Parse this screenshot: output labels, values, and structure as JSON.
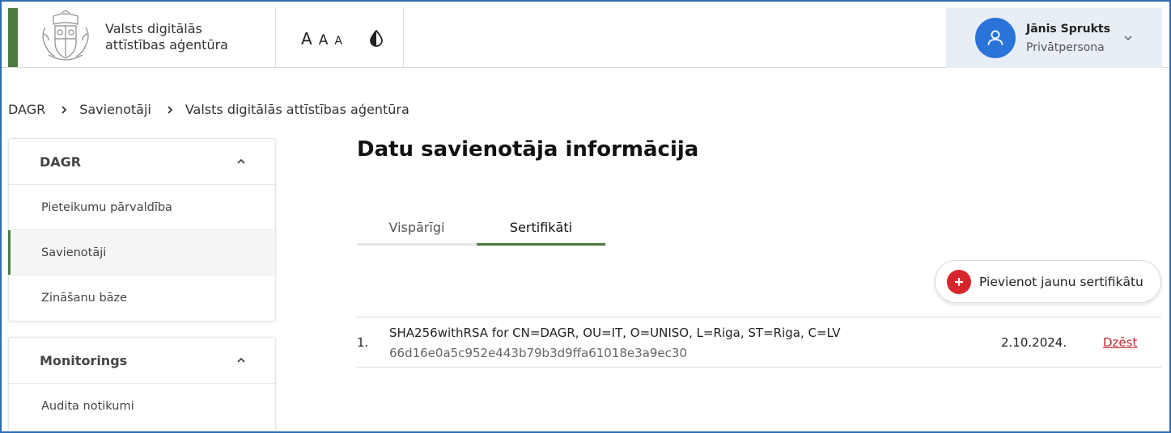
{
  "header": {
    "org_name_line1": "Valsts digitālās",
    "org_name_line2": "attīstības aģentūra",
    "font_size_large": "A",
    "font_size_medium": "A",
    "font_size_small": "A",
    "user": {
      "name": "Jānis Sprukts",
      "role": "Privātpersona"
    }
  },
  "breadcrumb": [
    "DAGR",
    "Savienotāji",
    "Valsts digitālās attīstības aģentūra"
  ],
  "sidebar": {
    "groups": [
      {
        "title": "DAGR",
        "items": [
          "Pieteikumu pārvaldība",
          "Savienotāji",
          "Zināšanu bāze"
        ]
      },
      {
        "title": "Monitorings",
        "items": [
          "Audita notikumi"
        ]
      }
    ]
  },
  "main": {
    "title": "Datu savienotāja informācija",
    "tabs": [
      "Vispārīgi",
      "Sertifikāti"
    ],
    "add_button_label": "Pievienot jaunu sertifikātu",
    "certificates": [
      {
        "index": "1.",
        "subject": "SHA256withRSA for CN=DAGR, OU=IT, O=UNISO, L=Riga, ST=Riga, C=LV",
        "hash": "66d16e0a5c952e443b79b3d9ffa61018e3a9ec30",
        "date": "2.10.2024.",
        "delete_label": "Dzēst"
      }
    ]
  },
  "colors": {
    "brand_green": "#4d7b3f",
    "accent_blue": "#2a73d9",
    "danger_red": "#d7262b"
  }
}
